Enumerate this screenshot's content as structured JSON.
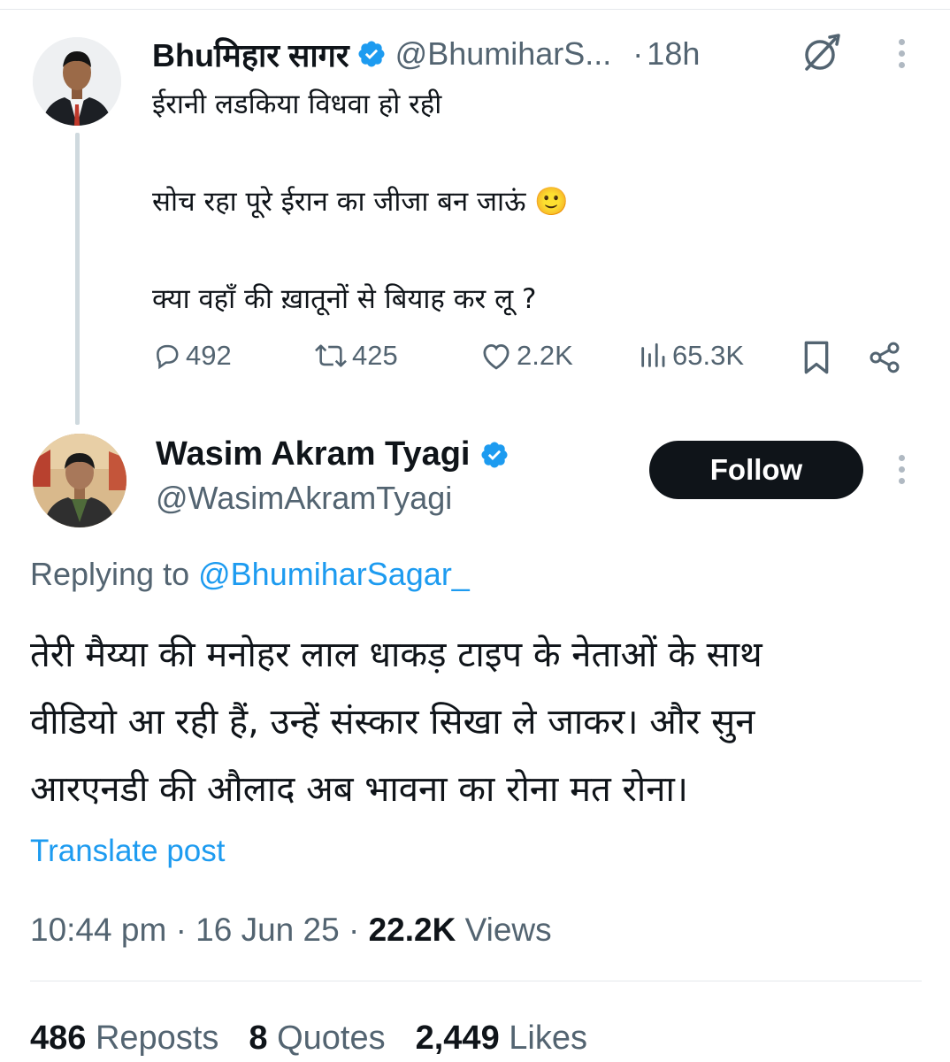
{
  "parent_tweet": {
    "display_name": "Bhuमिहार सागर",
    "handle": "@BhumiharS...",
    "separator": "·",
    "time": "18h",
    "lines": [
      "ईरानी लडकिया विधवा हो रही",
      "सोच रहा पूरे ईरान का जीजा बन जाऊं 🙂",
      "क्या वहाँ की ख़ातूनों से बियाह कर लू ?"
    ],
    "replies": "492",
    "reposts": "425",
    "likes": "2.2K",
    "views": "65.3K"
  },
  "main_tweet": {
    "display_name": "Wasim Akram Tyagi",
    "handle": "@WasimAkramTyagi",
    "follow_label": "Follow",
    "replying_prefix": "Replying to",
    "replying_handle": "@BhumiharSagar_",
    "lines": [
      "तेरी मैय्या की मनोहर लाल धाकड़ टाइप के नेताओं के साथ",
      "वीडियो आ रही हैं, उन्हें संस्कार सिखा  ले जाकर। और सुन",
      "आरएनडी की औलाद अब भावना का रोना मत रोना।"
    ],
    "translate_label": "Translate post",
    "time": "10:44 pm",
    "date": "16 Jun 25",
    "separator": "·",
    "views_count": "22.2K",
    "views_label": "Views"
  },
  "stats": {
    "reposts_count": "486",
    "reposts_label": "Reposts",
    "quotes_count": "8",
    "quotes_label": "Quotes",
    "likes_count": "2,449",
    "likes_label": "Likes"
  },
  "colors": {
    "accent": "#1d9bf0",
    "text": "#0f1419",
    "secondary": "#536471",
    "button_bg": "#0f1419"
  },
  "icons": [
    "verified-badge-icon",
    "grok-icon",
    "more-vertical-icon",
    "reply-icon",
    "repost-icon",
    "like-icon",
    "views-icon",
    "bookmark-icon",
    "share-icon"
  ]
}
